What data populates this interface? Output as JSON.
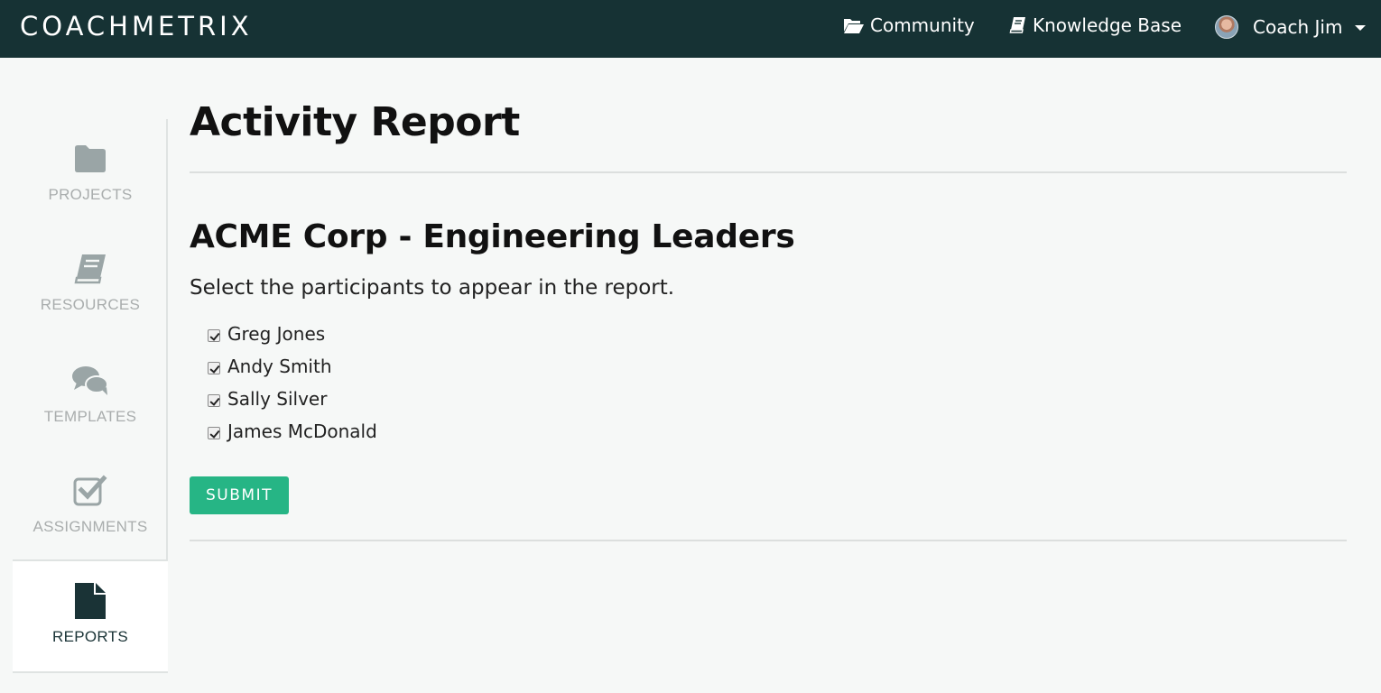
{
  "header": {
    "brand": "COACHMETRIX",
    "links": {
      "community": "Community",
      "knowledge_base": "Knowledge Base"
    },
    "user": {
      "name": "Coach Jim"
    }
  },
  "sidebar": {
    "items": [
      {
        "label": "PROJECTS",
        "icon": "folder-icon"
      },
      {
        "label": "RESOURCES",
        "icon": "book-icon"
      },
      {
        "label": "TEMPLATES",
        "icon": "comments-icon"
      },
      {
        "label": "ASSIGNMENTS",
        "icon": "checkbox-icon"
      },
      {
        "label": "REPORTS",
        "icon": "document-icon",
        "active": true
      }
    ]
  },
  "main": {
    "title": "Activity Report",
    "section_title": "ACME Corp - Engineering Leaders",
    "instructions": "Select the participants to appear in the report.",
    "participants": [
      {
        "name": "Greg Jones",
        "checked": true
      },
      {
        "name": "Andy Smith",
        "checked": true
      },
      {
        "name": "Sally Silver",
        "checked": true
      },
      {
        "name": "James McDonald",
        "checked": true
      }
    ],
    "submit_label": "SUBMIT"
  },
  "colors": {
    "topbar": "#163234",
    "accent": "#26b585",
    "sidebar_icon": "#9aa5a6",
    "active_icon": "#1a3336"
  }
}
